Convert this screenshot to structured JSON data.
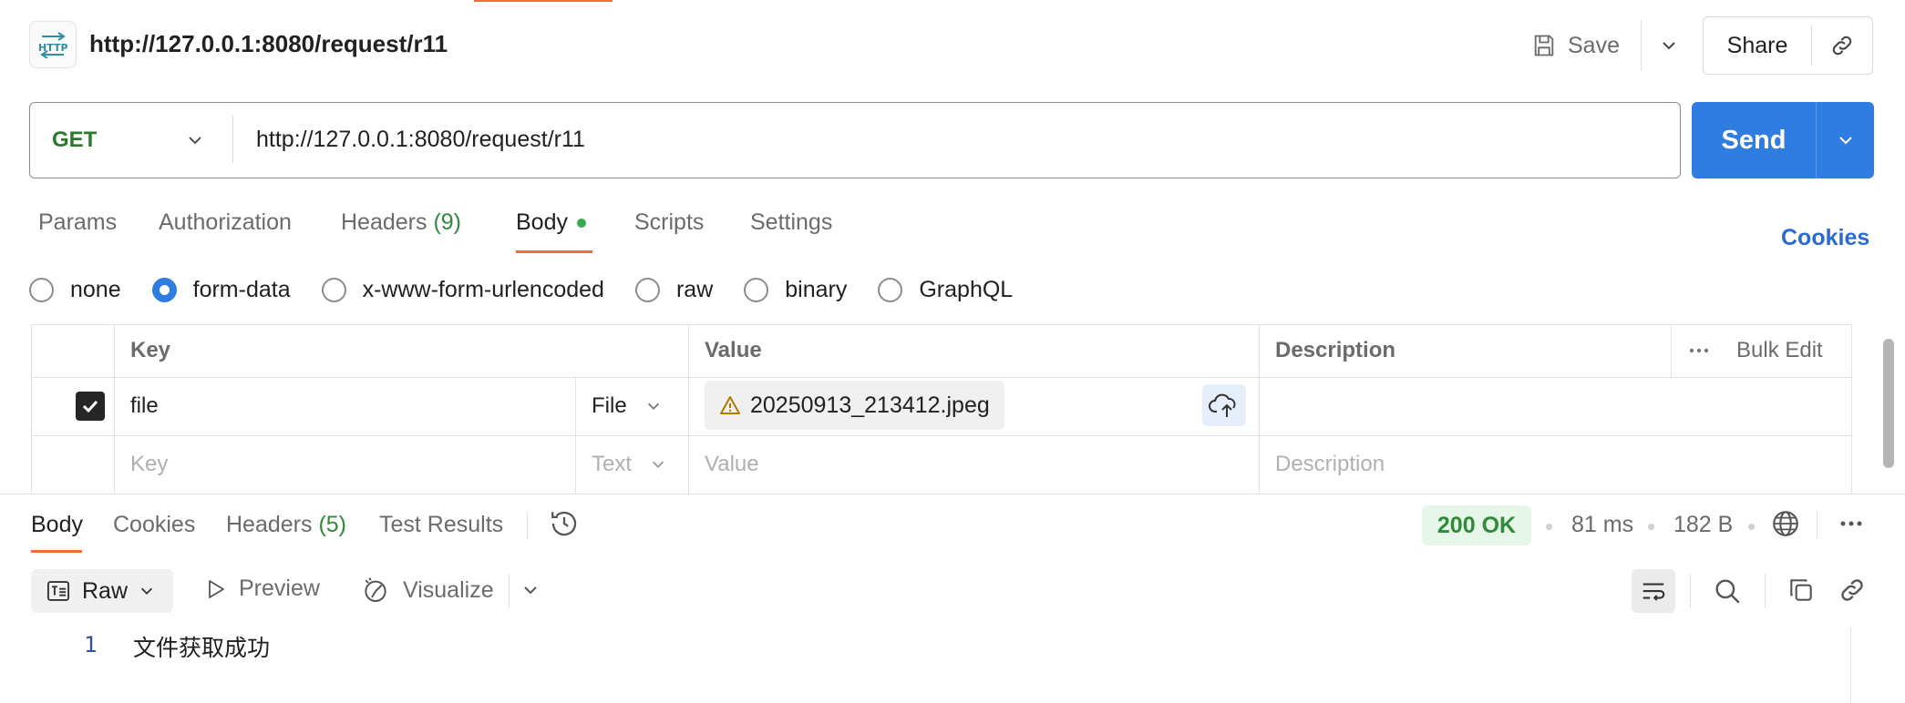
{
  "request": {
    "title": "http://127.0.0.1:8080/request/r11",
    "method": "GET",
    "url": "http://127.0.0.1:8080/request/r11",
    "icon": "http-icon"
  },
  "header": {
    "save_label": "Save",
    "share_label": "Share"
  },
  "send_label": "Send",
  "request_tabs": [
    {
      "label": "Params"
    },
    {
      "label": "Authorization"
    },
    {
      "label": "Headers",
      "count": "(9)"
    },
    {
      "label": "Body"
    },
    {
      "label": "Scripts"
    },
    {
      "label": "Settings"
    }
  ],
  "cookies_label": "Cookies",
  "body_types": [
    "none",
    "form-data",
    "x-www-form-urlencoded",
    "raw",
    "binary",
    "GraphQL"
  ],
  "body_type_selected": "form-data",
  "table": {
    "headers": {
      "key": "Key",
      "value": "Value",
      "description": "Description",
      "bulk_edit": "Bulk Edit"
    },
    "rows": [
      {
        "checked": true,
        "key": "file",
        "type": "File",
        "value": "20250913_213412.jpeg",
        "description": ""
      }
    ],
    "placeholder_row": {
      "key": "Key",
      "type": "Text",
      "value": "Value",
      "description": "Description"
    }
  },
  "response": {
    "tabs": [
      {
        "label": "Body"
      },
      {
        "label": "Cookies"
      },
      {
        "label": "Headers",
        "count": "(5)"
      },
      {
        "label": "Test Results"
      }
    ],
    "status": "200 OK",
    "time": "81 ms",
    "size": "182 B",
    "format": "Raw",
    "preview_label": "Preview",
    "visualize_label": "Visualize",
    "lines": [
      {
        "no": "1",
        "text": "文件获取成功"
      }
    ]
  },
  "colors": {
    "accent": "#f26b3a",
    "send": "#2f7de1",
    "method": "#2b7a2b",
    "status_ok": "#2f8a3a"
  }
}
